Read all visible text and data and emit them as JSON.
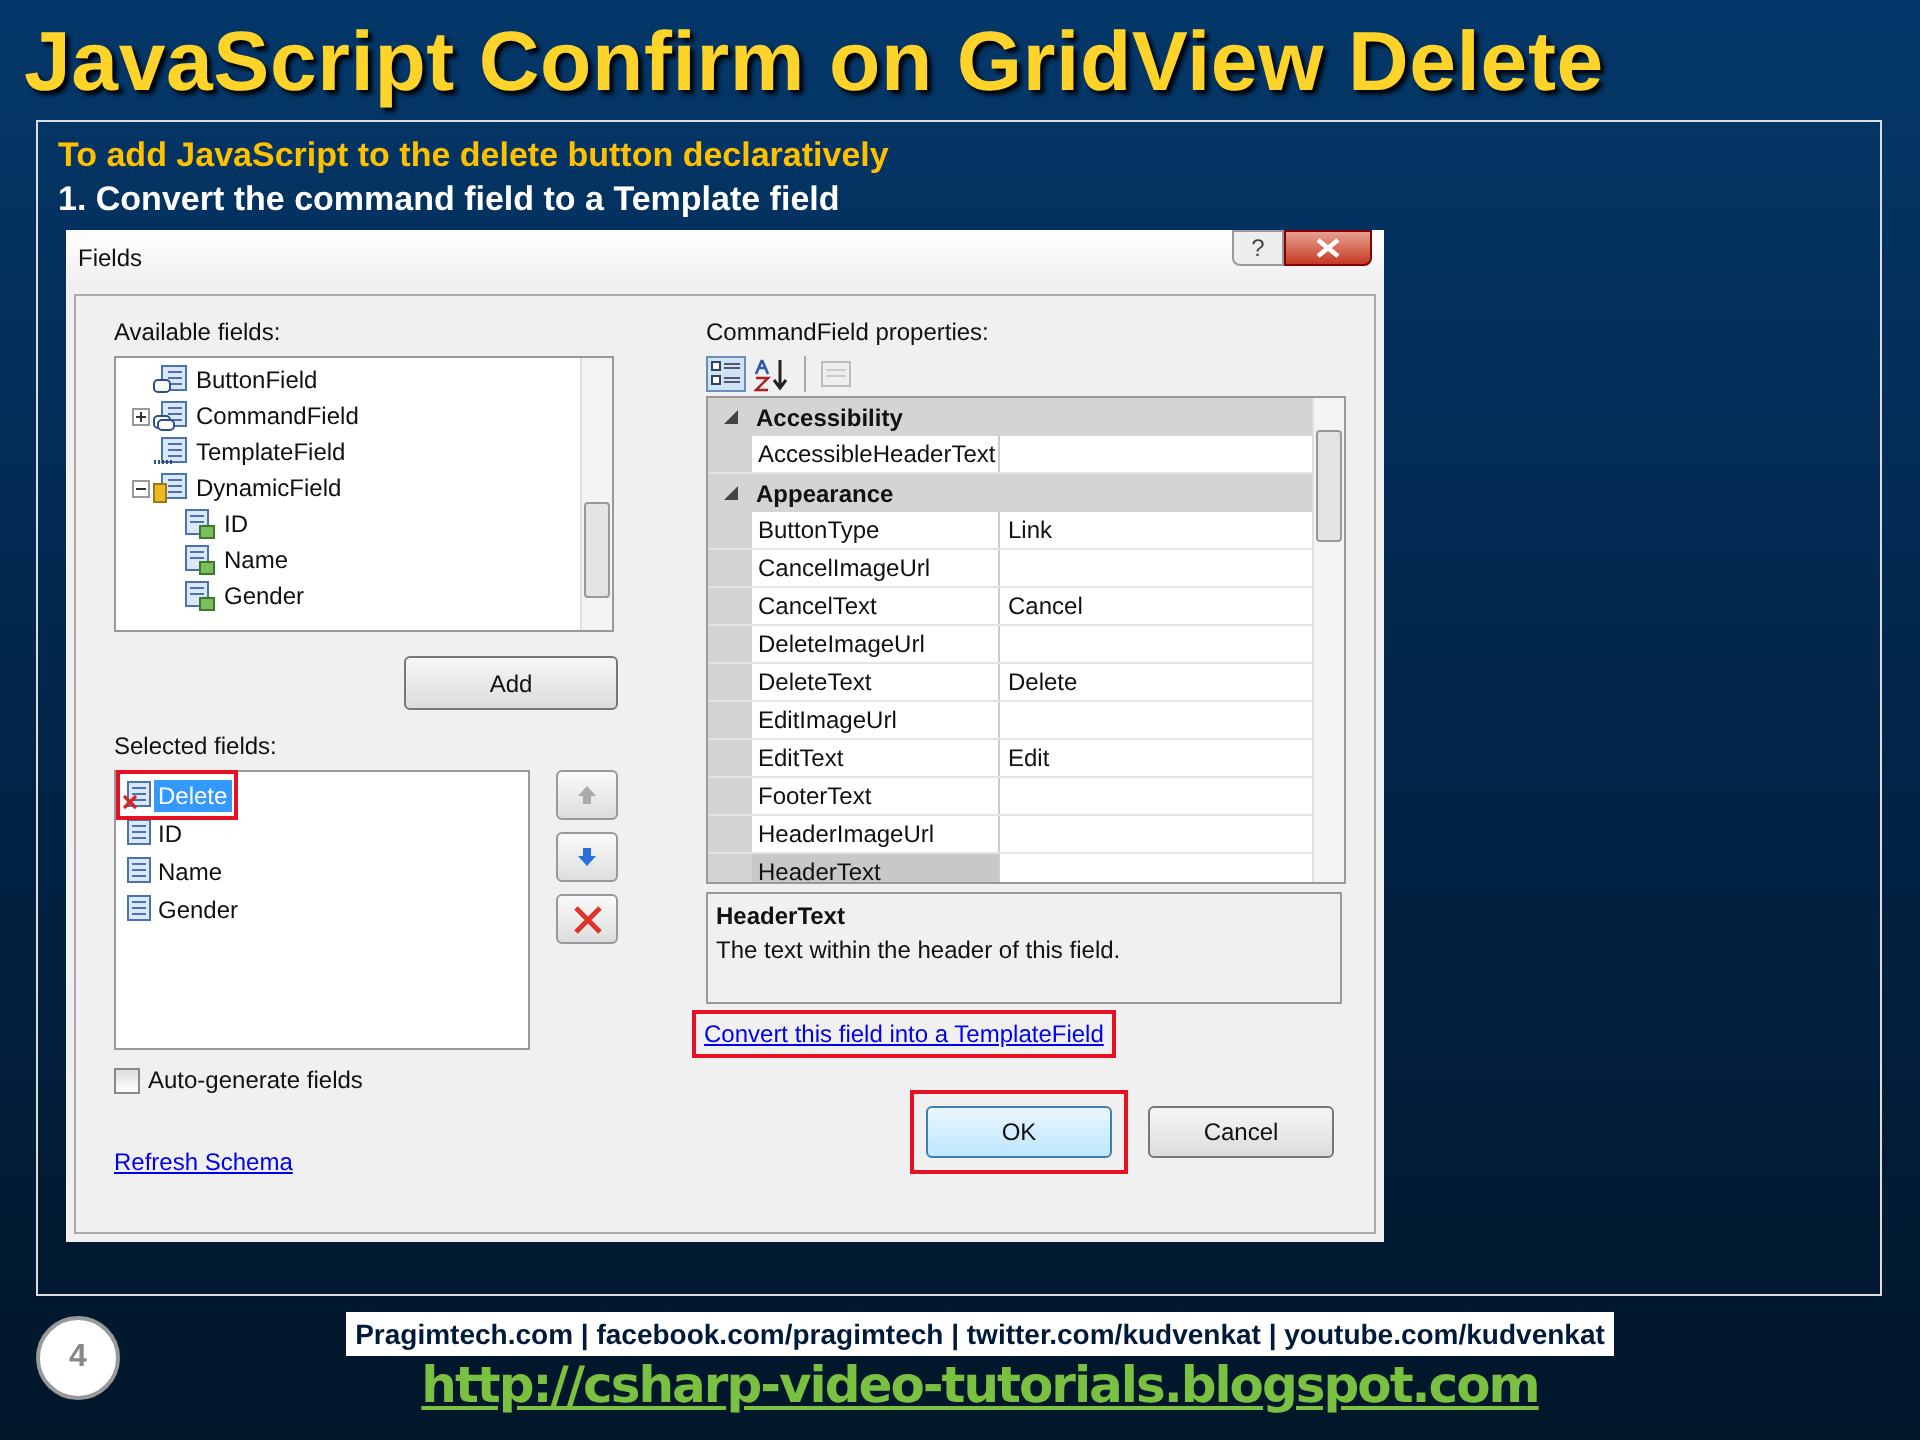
{
  "slide": {
    "title": "JavaScript Confirm on GridView Delete",
    "subtitle": "To add JavaScript to the delete button declaratively",
    "step": "1. Convert the command field to a Template field"
  },
  "dialog": {
    "title": "Fields",
    "help_button": "?",
    "available_label": "Available fields:",
    "tree": [
      {
        "label": "ButtonField",
        "kind": "button"
      },
      {
        "label": "CommandField",
        "kind": "command",
        "expanded": false
      },
      {
        "label": "TemplateField",
        "kind": "template"
      },
      {
        "label": "DynamicField",
        "kind": "dynamic",
        "expanded": true,
        "children": [
          {
            "label": "ID"
          },
          {
            "label": "Name"
          },
          {
            "label": "Gender"
          }
        ]
      }
    ],
    "add_button": "Add",
    "selected_label": "Selected fields:",
    "selected_fields": [
      {
        "label": "Delete",
        "kind": "command",
        "selected": true,
        "highlighted": true
      },
      {
        "label": "ID",
        "kind": "bound",
        "selected": false,
        "highlighted": false
      },
      {
        "label": "Name",
        "kind": "bound",
        "selected": false,
        "highlighted": false
      },
      {
        "label": "Gender",
        "kind": "bound",
        "selected": false,
        "highlighted": false
      }
    ],
    "auto_generate": {
      "label": "Auto-generate fields",
      "checked": false
    },
    "refresh_link": "Refresh Schema",
    "properties_label": "CommandField properties:",
    "categories": [
      {
        "name": "Accessibility",
        "expanded": true,
        "rows": [
          {
            "name": "AccessibleHeaderText",
            "value": "",
            "selected": false
          }
        ]
      },
      {
        "name": "Appearance",
        "expanded": true,
        "rows": [
          {
            "name": "ButtonType",
            "value": "Link",
            "selected": false
          },
          {
            "name": "CancelImageUrl",
            "value": "",
            "selected": false
          },
          {
            "name": "CancelText",
            "value": "Cancel",
            "selected": false
          },
          {
            "name": "DeleteImageUrl",
            "value": "",
            "selected": false
          },
          {
            "name": "DeleteText",
            "value": "Delete",
            "selected": false
          },
          {
            "name": "EditImageUrl",
            "value": "",
            "selected": false
          },
          {
            "name": "EditText",
            "value": "Edit",
            "selected": false
          },
          {
            "name": "FooterText",
            "value": "",
            "selected": false
          },
          {
            "name": "HeaderImageUrl",
            "value": "",
            "selected": false
          },
          {
            "name": "HeaderText",
            "value": "",
            "selected": true
          }
        ]
      }
    ],
    "description": {
      "title": "HeaderText",
      "text": "The text within the header of this field."
    },
    "convert_link": {
      "label": "Convert this field into a TemplateField",
      "highlighted": true
    },
    "buttons": [
      {
        "label": "OK",
        "default": true,
        "highlighted": true
      },
      {
        "label": "Cancel",
        "default": false,
        "highlighted": false
      }
    ]
  },
  "footer": {
    "page_number": "4",
    "links": "Pragimtech.com | facebook.com/pragimtech | twitter.com/kudvenkat | youtube.com/kudvenkat",
    "url": "http://csharp-video-tutorials.blogspot.com"
  }
}
